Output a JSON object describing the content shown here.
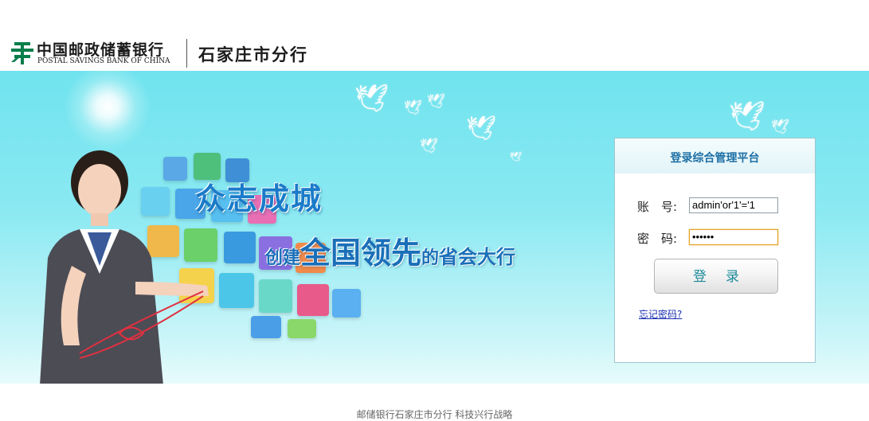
{
  "header": {
    "bank_name_cn": "中国邮政储蓄银行",
    "bank_name_en": "POSTAL SAVINGS BANK OF CHINA",
    "branch_name": "石家庄市分行"
  },
  "banner": {
    "slogan_line1": "众志成城",
    "slogan_line2_prefix": "创建",
    "slogan_line2_highlight": "全国领先",
    "slogan_line2_mid": "的",
    "slogan_line2_suffix": "省会大行"
  },
  "login": {
    "title": "登录综合管理平台",
    "username_label": "账　号:",
    "username_value": "admin'or'1'='1",
    "password_label": "密　码:",
    "password_value": "••••••",
    "submit_label": "登录",
    "forgot_link": "忘记密码?"
  },
  "footer": {
    "text": "邮储银行石家庄市分行  科技兴行战略"
  },
  "colors": {
    "brand_green": "#0a7d4b",
    "title_blue": "#1d6fa5",
    "slogan_blue": "#1a7bc9",
    "banner_top": "#6fe3ee",
    "link": "#1a2fb0"
  }
}
